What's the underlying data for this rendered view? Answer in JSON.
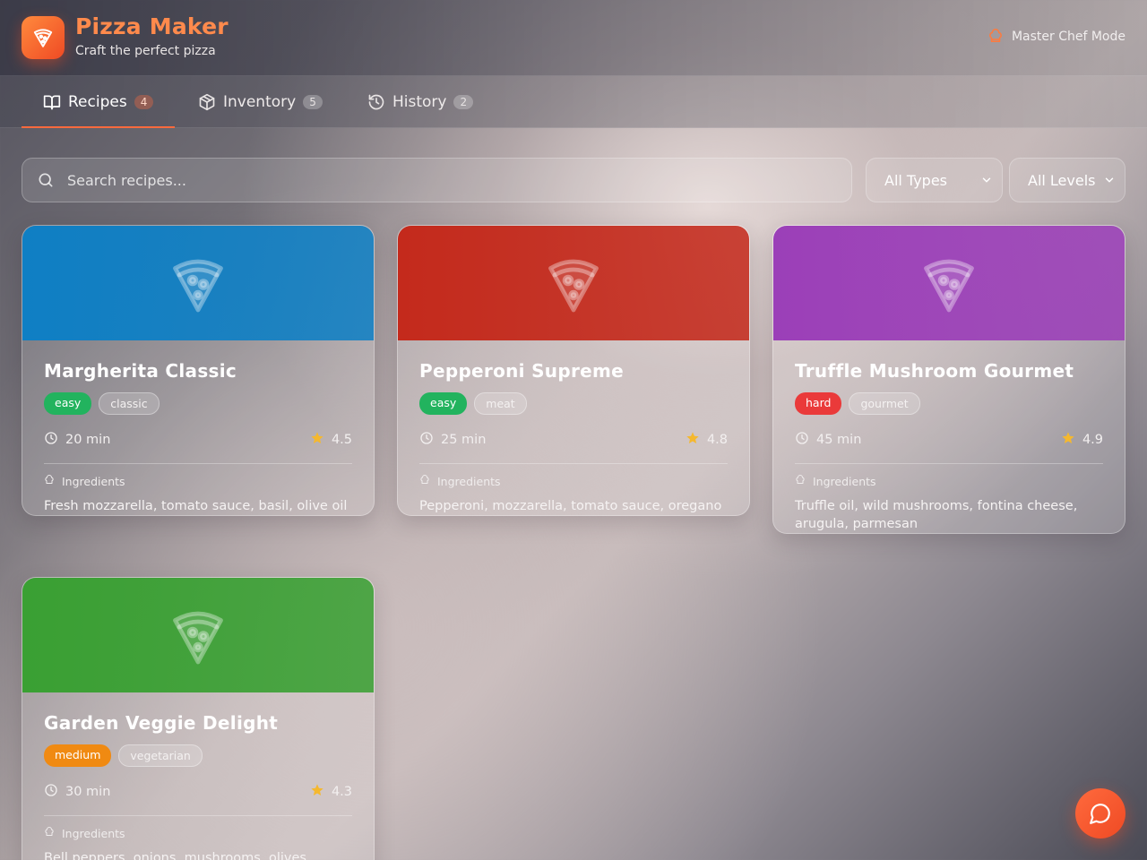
{
  "app": {
    "title": "Pizza Maker",
    "subtitle": "Craft the perfect pizza",
    "chef_mode_label": "Master Chef Mode"
  },
  "tabs": [
    {
      "label": "Recipes",
      "count": "4",
      "active": true,
      "icon": "book-open-icon"
    },
    {
      "label": "Inventory",
      "count": "5",
      "active": false,
      "icon": "package-icon"
    },
    {
      "label": "History",
      "count": "2",
      "active": false,
      "icon": "history-icon"
    }
  ],
  "search": {
    "placeholder": "Search recipes..."
  },
  "filters": {
    "type": {
      "selected": "All Types"
    },
    "level": {
      "selected": "All Levels"
    }
  },
  "recipes": [
    {
      "name": "Margherita Classic",
      "difficulty": "easy",
      "category": "classic",
      "time": "20 min",
      "rating": "4.5",
      "ingredients_label": "Ingredients",
      "ingredients": "Fresh mozzarella, tomato sauce, basil, olive oil",
      "hero_color": "#0f7fc4"
    },
    {
      "name": "Pepperoni Supreme",
      "difficulty": "easy",
      "category": "meat",
      "time": "25 min",
      "rating": "4.8",
      "ingredients_label": "Ingredients",
      "ingredients": "Pepperoni, mozzarella, tomato sauce, oregano",
      "hero_color": "#c42a1c"
    },
    {
      "name": "Truffle Mushroom Gourmet",
      "difficulty": "hard",
      "category": "gourmet",
      "time": "45 min",
      "rating": "4.9",
      "ingredients_label": "Ingredients",
      "ingredients": "Truffle oil, wild mushrooms, fontina cheese, arugula, parmesan",
      "hero_color": "#9b3fb8"
    },
    {
      "name": "Garden Veggie Delight",
      "difficulty": "medium",
      "category": "vegetarian",
      "time": "30 min",
      "rating": "4.3",
      "ingredients_label": "Ingredients",
      "ingredients": "Bell peppers, onions, mushrooms, olives",
      "hero_color": "#3aa033"
    }
  ],
  "colors": {
    "accent": "#ff6a3d",
    "easy": "#22b35e",
    "medium": "#f08a12",
    "hard": "#ea3a3a",
    "star": "#f5b82e"
  }
}
